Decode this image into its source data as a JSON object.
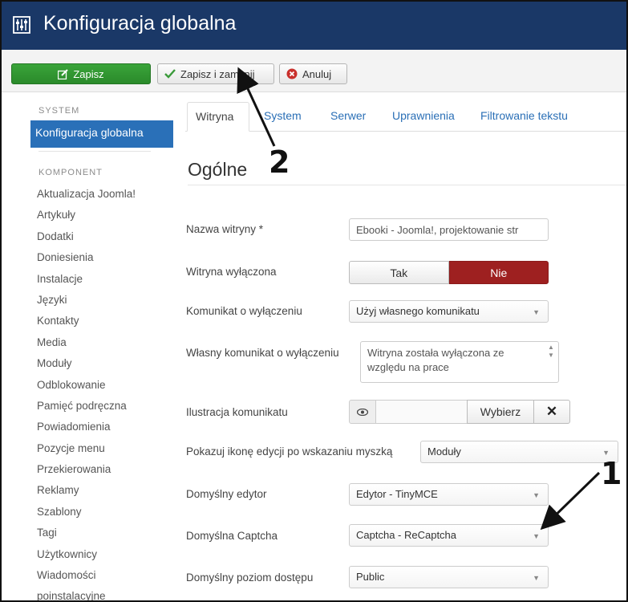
{
  "header": {
    "title": "Konfiguracja globalna",
    "icon": "sliders-icon"
  },
  "toolbar": {
    "save_label": "Zapisz",
    "save_close_label": "Zapisz i zamknij",
    "cancel_label": "Anuluj",
    "colors": {
      "save": "#2a8a2a",
      "cancel_icon": "#c9302c"
    }
  },
  "sidebar": {
    "system_heading": "SYSTEM",
    "active_item": "Konfiguracja globalna",
    "component_heading": "KOMPONENT",
    "items": [
      "Aktualizacja Joomla!",
      "Artykuły",
      "Dodatki",
      "Doniesienia",
      "Instalacje",
      "Języki",
      "Kontakty",
      "Media",
      "Moduły",
      "Odblokowanie",
      "Pamięć podręczna",
      "Powiadomienia",
      "Pozycje menu",
      "Przekierowania",
      "Reklamy",
      "Szablony",
      "Tagi",
      "Użytkownicy",
      "Wiadomości",
      "poinstalacyjne"
    ]
  },
  "tabs": [
    "Witryna",
    "System",
    "Serwer",
    "Uprawnienia",
    "Filtrowanie tekstu"
  ],
  "section": {
    "title": "Ogólne"
  },
  "form": {
    "site_name": {
      "label": "Nazwa witryny *",
      "value": "Ebooki - Joomla!, projektowanie str"
    },
    "offline": {
      "label": "Witryna wyłączona",
      "yes": "Tak",
      "no": "Nie",
      "selected": "Nie"
    },
    "offline_message": {
      "label": "Komunikat o wyłączeniu",
      "value": "Użyj własnego komunikatu"
    },
    "custom_message": {
      "label": "Własny komunikat o wyłączeniu",
      "value_line1": "Witryna została wyłączona ze",
      "value_line2": "względu na prace"
    },
    "offline_image": {
      "label": "Ilustracja komunikatu",
      "select_label": "Wybierz"
    },
    "frontend_edit": {
      "label": "Pokazuj ikonę edycji po wskazaniu myszką",
      "value": "Moduły"
    },
    "default_editor": {
      "label": "Domyślny edytor",
      "value": "Edytor - TinyMCE"
    },
    "default_captcha": {
      "label": "Domyślna Captcha",
      "value": "Captcha - ReCaptcha"
    },
    "default_access": {
      "label": "Domyślny poziom dostępu",
      "value": "Public"
    }
  },
  "annotations": {
    "one": "1",
    "two": "2"
  }
}
